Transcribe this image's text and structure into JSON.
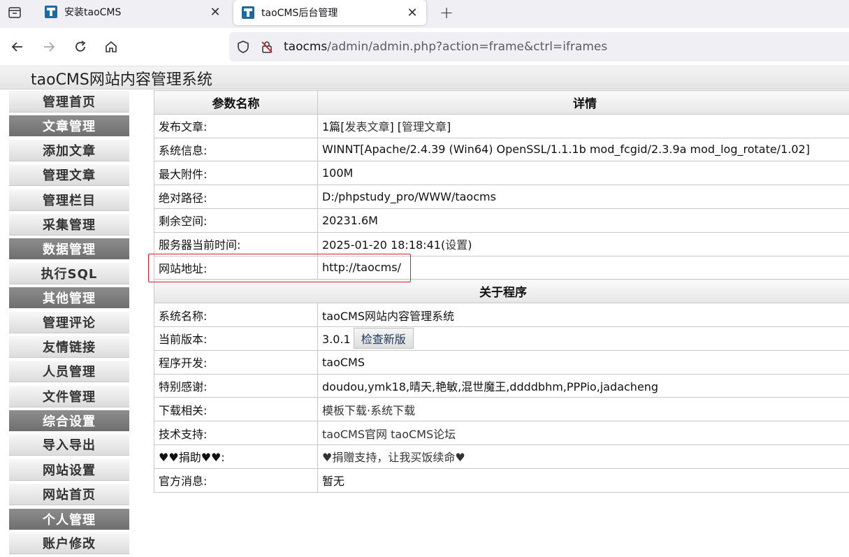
{
  "browser": {
    "tabs": [
      {
        "title": "安装taoCMS",
        "active": false
      },
      {
        "title": "taoCMS后台管理",
        "active": true
      }
    ],
    "url": {
      "host": "taocms",
      "path": "/admin/admin.php?action=frame&ctrl=iframes"
    }
  },
  "app": {
    "title": "taoCMS网站内容管理系统"
  },
  "sidebar": {
    "items": [
      {
        "label": "管理首页",
        "type": "link"
      },
      {
        "label": "文章管理",
        "type": "group"
      },
      {
        "label": "添加文章",
        "type": "link"
      },
      {
        "label": "管理文章",
        "type": "link"
      },
      {
        "label": "管理栏目",
        "type": "link"
      },
      {
        "label": "采集管理",
        "type": "link"
      },
      {
        "label": "数据管理",
        "type": "group"
      },
      {
        "label": "执行SQL",
        "type": "link"
      },
      {
        "label": "其他管理",
        "type": "group"
      },
      {
        "label": "管理评论",
        "type": "link"
      },
      {
        "label": "友情链接",
        "type": "link"
      },
      {
        "label": "人员管理",
        "type": "link"
      },
      {
        "label": "文件管理",
        "type": "link"
      },
      {
        "label": "综合设置",
        "type": "group"
      },
      {
        "label": "导入导出",
        "type": "link"
      },
      {
        "label": "网站设置",
        "type": "link"
      },
      {
        "label": "网站首页",
        "type": "link"
      },
      {
        "label": "个人管理",
        "type": "group"
      },
      {
        "label": "账户修改",
        "type": "link"
      }
    ]
  },
  "params": {
    "header_name": "参数名称",
    "header_detail": "详情",
    "rows": {
      "articles": {
        "key": "发布文章:",
        "count": "1篇",
        "post_link": "发表文章",
        "manage_link": "管理文章"
      },
      "sysinfo": {
        "key": "系统信息:",
        "value": "WINNT[Apache/2.4.39 (Win64) OpenSSL/1.1.1b mod_fcgid/2.3.9a mod_log_rotate/1.02]"
      },
      "max_attach": {
        "key": "最大附件:",
        "value": "100M"
      },
      "abs_path": {
        "key": "绝对路径:",
        "value": "D:/phpstudy_pro/WWW/taocms"
      },
      "free_space": {
        "key": "剩余空间:",
        "value": "20231.6M"
      },
      "server_time": {
        "key": "服务器当前时间:",
        "value": "2025-01-20 18:18:41",
        "set_link": "设置"
      },
      "site_url": {
        "key": "网站地址:",
        "value": "http://taocms/"
      }
    }
  },
  "about": {
    "header": "关于程序",
    "rows": {
      "sys_name": {
        "key": "系统名称:",
        "value": "taoCMS网站内容管理系统"
      },
      "version": {
        "key": "当前版本:",
        "value": "3.0.1",
        "button": "检查新版"
      },
      "developer": {
        "key": "程序开发:",
        "value": "taoCMS"
      },
      "thanks": {
        "key": "特别感谢:",
        "value": "doudou,ymk18,晴天,艳敏,混世魔王,ddddbhm,PPPio,jadacheng"
      },
      "downloads": {
        "key": "下载相关:",
        "template_link": "模板下载",
        "sep": "·",
        "system_link": "系统下载"
      },
      "support": {
        "key": "技术支持:",
        "site_link": "taoCMS官网",
        "forum_link": "taoCMS论坛"
      },
      "donate": {
        "key": "♥♥捐助♥♥:",
        "value": "♥捐赠支持，让我买饭续命♥"
      },
      "news": {
        "key": "官方消息:",
        "value": "暂无"
      }
    }
  }
}
